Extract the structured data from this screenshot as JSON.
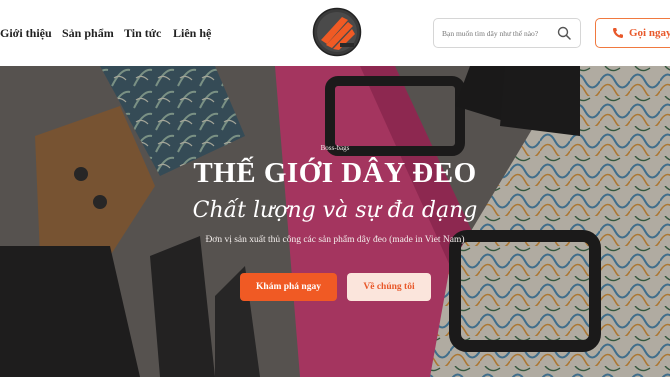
{
  "nav": {
    "items": [
      "Giới thiệu",
      "Sản phẩm",
      "Tin tức",
      "Liên hệ"
    ]
  },
  "logo": {
    "icon": "boss-bags-logo",
    "colors": [
      "#f05a24",
      "#3b3b3b"
    ]
  },
  "search": {
    "placeholder": "Bạn muốn tìm dây như thế nào?",
    "icon": "search-icon"
  },
  "call": {
    "label": "Gọi ngay",
    "icon": "phone-icon",
    "color": "#e8582a"
  },
  "hero": {
    "eyebrow": "Boss-bags",
    "title": "THẾ GIỚI DÂY ĐEO",
    "subtitle": "Chất lượng và sự đa dạng",
    "description": "Đơn vị sản xuất thủ công các sản phẩm dây đeo (made in Viet Nam)",
    "primary_button": "Khám phá ngay",
    "secondary_button": "Về chúng tôi",
    "accent": "#f05a24"
  }
}
